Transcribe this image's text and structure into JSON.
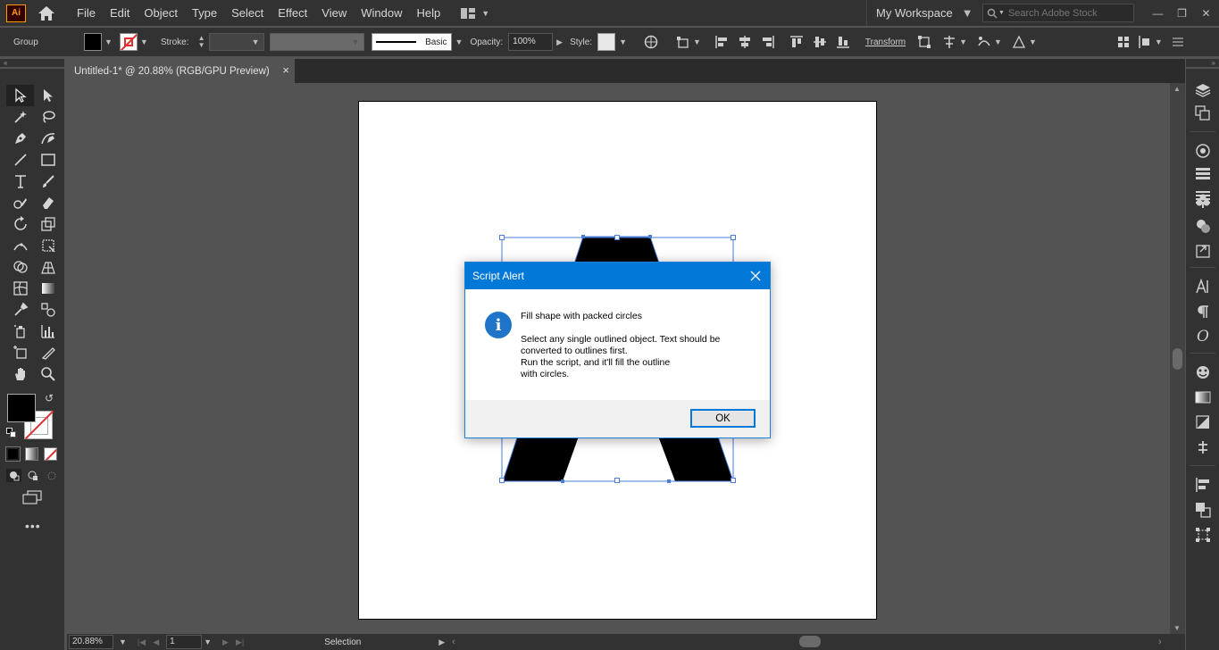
{
  "app": {
    "logo": "Ai"
  },
  "menu": [
    "File",
    "Edit",
    "Object",
    "Type",
    "Select",
    "Effect",
    "View",
    "Window",
    "Help"
  ],
  "workspace": {
    "label": "My Workspace"
  },
  "stock_search": {
    "placeholder": "Search Adobe Stock"
  },
  "control_bar": {
    "selection_type": "Group",
    "stroke_label": "Stroke:",
    "stroke_profile": "Basic",
    "opacity_label": "Opacity:",
    "opacity_value": "100%",
    "style_label": "Style:",
    "transform_label": "Transform"
  },
  "document": {
    "tab_title": "Untitled-1* @ 20.88% (RGB/GPU Preview)"
  },
  "status_bar": {
    "zoom": "20.88%",
    "artboard_number": "1",
    "tool": "Selection"
  },
  "dialog": {
    "title": "Script Alert",
    "heading": "Fill shape with packed circles",
    "lines": [
      "Select any single outlined object. Text should be",
      "converted to outlines first.",
      "Run the script, and it'll fill the outline",
      "with circles."
    ],
    "ok_label": "OK"
  },
  "colors": {
    "accent": "#0078d7",
    "fill": "#000000",
    "selection": "#4a7cd8",
    "app_logo": "#ff9a00"
  }
}
